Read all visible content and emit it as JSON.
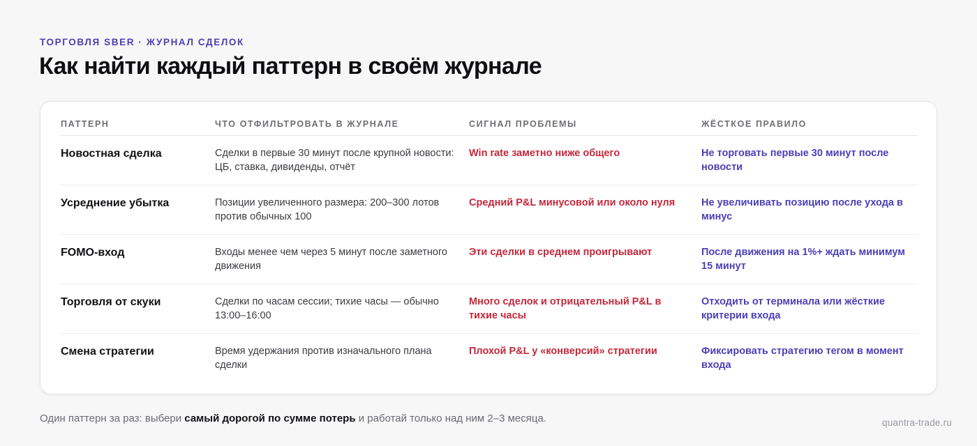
{
  "header": {
    "eyebrow": "ТОРГОВЛЯ SBER · ЖУРНАЛ СДЕЛОК",
    "title": "Как найти каждый паттерн в своём журнале"
  },
  "table": {
    "columns": [
      "ПАТТЕРН",
      "ЧТО ОТФИЛЬТРОВАТЬ В ЖУРНАЛЕ",
      "СИГНАЛ ПРОБЛЕМЫ",
      "ЖЁСТКОЕ ПРАВИЛО"
    ],
    "rows": [
      {
        "pattern": "Новостная сделка",
        "filter": "Сделки в первые 30 минут после крупной новости: ЦБ, ставка, дивиденды, отчёт",
        "signal": "Win rate заметно ниже общего",
        "rule": "Не торговать первые 30 минут после новости"
      },
      {
        "pattern": "Усреднение убытка",
        "filter": "Позиции увеличенного размера: 200–300 лотов против обычных 100",
        "signal": "Средний P&L минусовой или около нуля",
        "rule": "Не увеличивать позицию после ухода в минус"
      },
      {
        "pattern": "FOMO-вход",
        "filter": "Входы менее чем через 5 минут после заметного движения",
        "signal": "Эти сделки в среднем проигрывают",
        "rule": "После движения на 1%+ ждать минимум 15 минут"
      },
      {
        "pattern": "Торговля от скуки",
        "filter": "Сделки по часам сессии; тихие часы — обычно 13:00–16:00",
        "signal": "Много сделок и отрицательный P&L в тихие часы",
        "rule": "Отходить от терминала или жёсткие критерии входа"
      },
      {
        "pattern": "Смена стратегии",
        "filter": "Время удержания против изначального плана сделки",
        "signal": "Плохой P&L у «конверсий» стратегии",
        "rule": "Фиксировать стратегию тегом в момент входа"
      }
    ]
  },
  "footer": {
    "text_before": "Один паттерн за раз: выбери ",
    "text_bold": "самый дорогой по сумме потерь",
    "text_after": " и работай только над ним 2–3 месяца.",
    "site": "quantra-trade.ru"
  },
  "colors": {
    "accent": "#4b3fb5",
    "signal": "#c4283c",
    "background": "#f7f7f8",
    "card": "#ffffff"
  }
}
